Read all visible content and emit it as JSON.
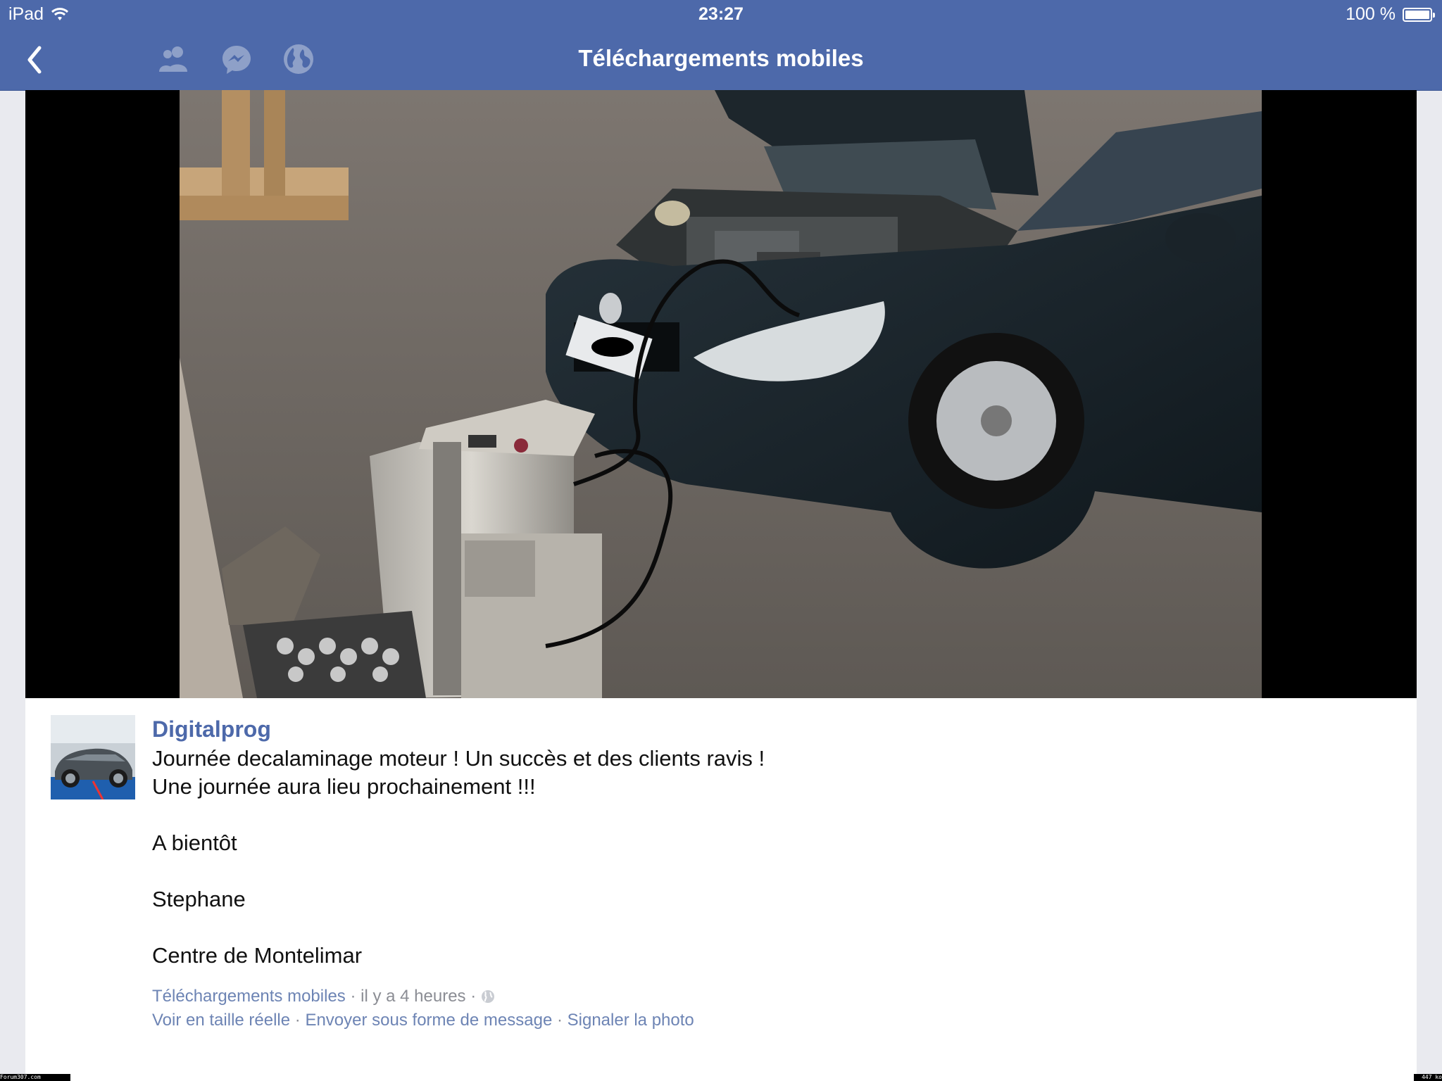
{
  "status_bar": {
    "device": "iPad",
    "time": "23:27",
    "battery": "100 %",
    "battery_level": 1.0,
    "icons": [
      "wifi-icon",
      "battery-icon"
    ]
  },
  "nav": {
    "title": "Téléchargements mobiles",
    "icons": [
      "back-chevron-icon",
      "friends-icon",
      "messenger-icon",
      "globe-icon"
    ]
  },
  "post": {
    "author": "Digitalprog",
    "lines": [
      "Journée decalaminage moteur ! Un succès et des clients ravis !",
      "Une journée aura lieu prochainement !!!",
      "A bientôt",
      "Stephane",
      "Centre de Montelimar"
    ],
    "album": "Téléchargements mobiles",
    "time_ago": "il y a 4 heures",
    "privacy_icon": "globe-icon",
    "actions": [
      "Voir en taille réelle",
      "Envoyer sous forme de message",
      "Signaler la photo"
    ],
    "separator": " · "
  },
  "watermark": {
    "left": "Forum307.com",
    "right": "447 ko"
  },
  "colors": {
    "brand": "#4d69aa",
    "link": "#6d84b4"
  }
}
